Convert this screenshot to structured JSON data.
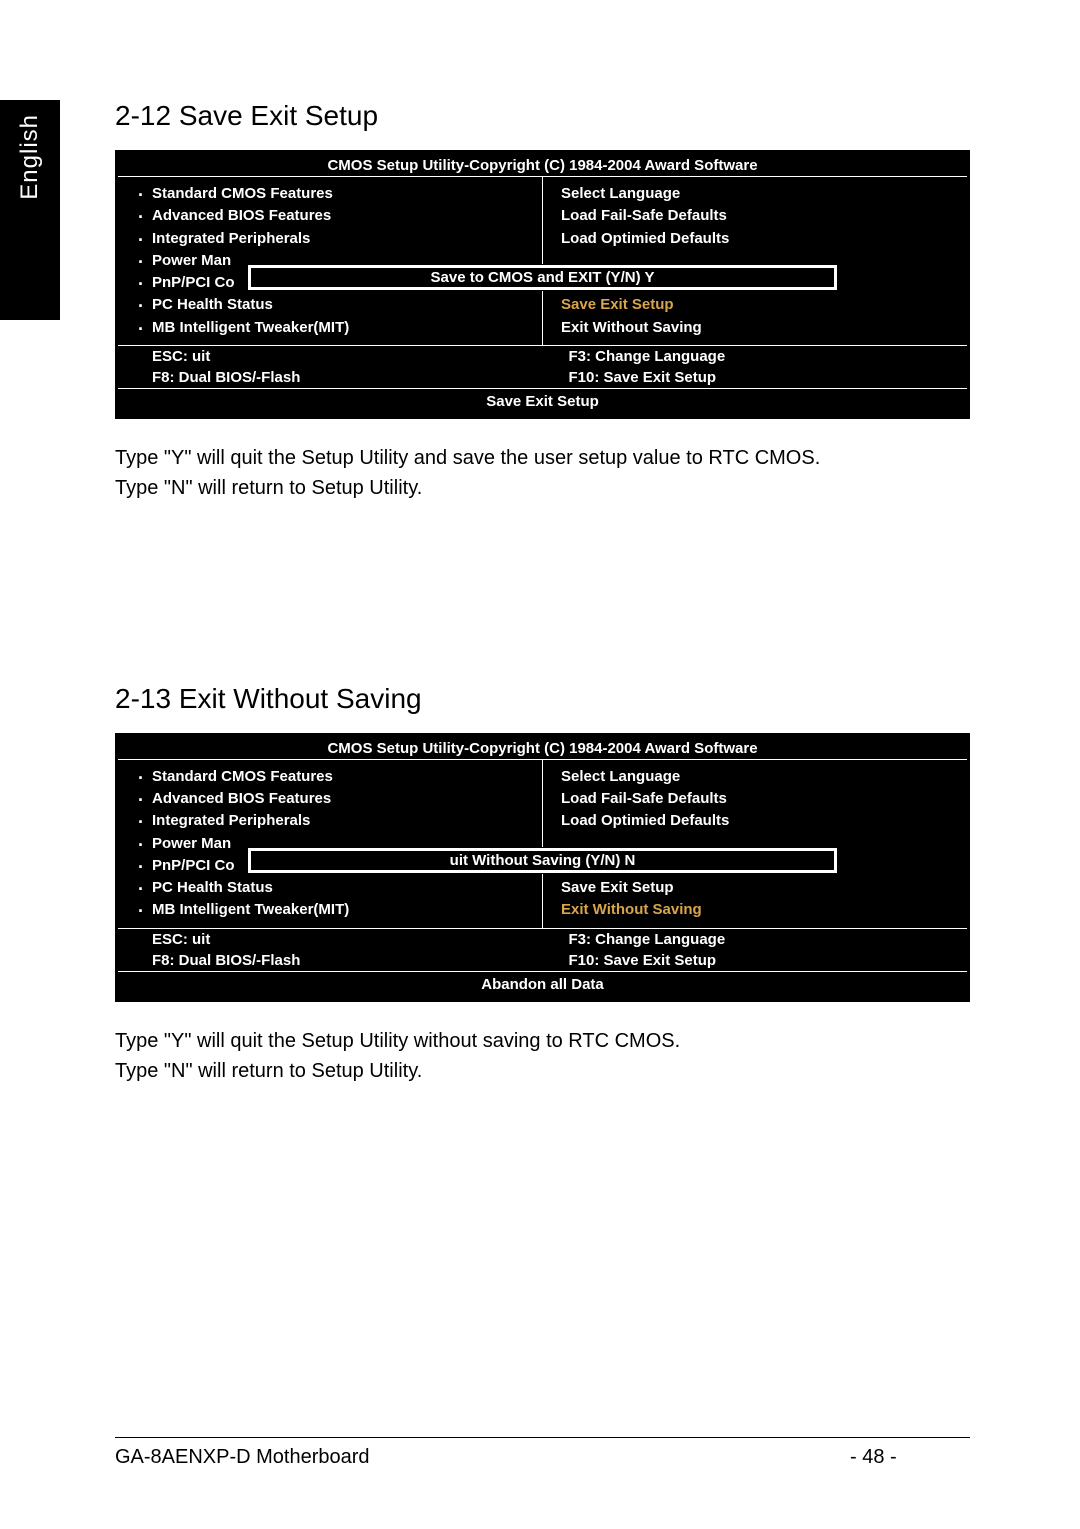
{
  "language_tab": "English",
  "section1": {
    "heading": "2-12   Save  Exit Setup",
    "bios": {
      "title": "CMOS Setup Utility-Copyright (C) 1984-2004 Award Software",
      "left_items": [
        "Standard CMOS Features",
        "Advanced BIOS Features",
        "Integrated Peripherals",
        "Power Man",
        "PnP/PCI Co",
        "PC Health Status",
        "MB Intelligent Tweaker(MIT)"
      ],
      "right_items": [
        "Select Language",
        "Load Fail-Safe Defaults",
        "Load Optimied Defaults",
        "",
        "",
        "Save  Exit Setup",
        "Exit Without Saving"
      ],
      "overlay": "Save to CMOS and EXIT (Y/N) Y",
      "hints": {
        "esc": "ESC: uit",
        "f3": "F3: Change Language",
        "f8": "F8: Dual BIOS/-Flash",
        "f10": "F10: Save  Exit Setup"
      },
      "footer": "Save  Exit Setup"
    },
    "desc_line1": "Type \"Y\" will quit the Setup Utility and save the user setup value to RTC CMOS.",
    "desc_line2": "Type \"N\" will return to Setup Utility."
  },
  "section2": {
    "heading": "2-13   Exit Without Saving",
    "bios": {
      "title": "CMOS Setup Utility-Copyright (C) 1984-2004 Award Software",
      "left_items": [
        "Standard CMOS Features",
        "Advanced BIOS Features",
        "Integrated Peripherals",
        "Power Man",
        "PnP/PCI Co",
        "PC Health Status",
        "MB Intelligent Tweaker(MIT)"
      ],
      "right_items": [
        "Select Language",
        "Load Fail-Safe Defaults",
        "Load Optimied Defaults",
        "",
        "",
        "Save  Exit Setup",
        "Exit Without Saving"
      ],
      "overlay": "uit Without      Saving (Y/N) N",
      "hints": {
        "esc": "ESC: uit",
        "f3": "F3: Change Language",
        "f8": "F8: Dual BIOS/-Flash",
        "f10": "F10: Save  Exit Setup"
      },
      "footer": "Abandon all Data"
    },
    "desc_line1": "Type \"Y\" will quit the Setup Utility without saving to RTC CMOS.",
    "desc_line2": "Type \"N\" will return to Setup Utility."
  },
  "page_footer": {
    "left": "GA-8AENXP-D Motherboard",
    "center": "- 48 -"
  }
}
